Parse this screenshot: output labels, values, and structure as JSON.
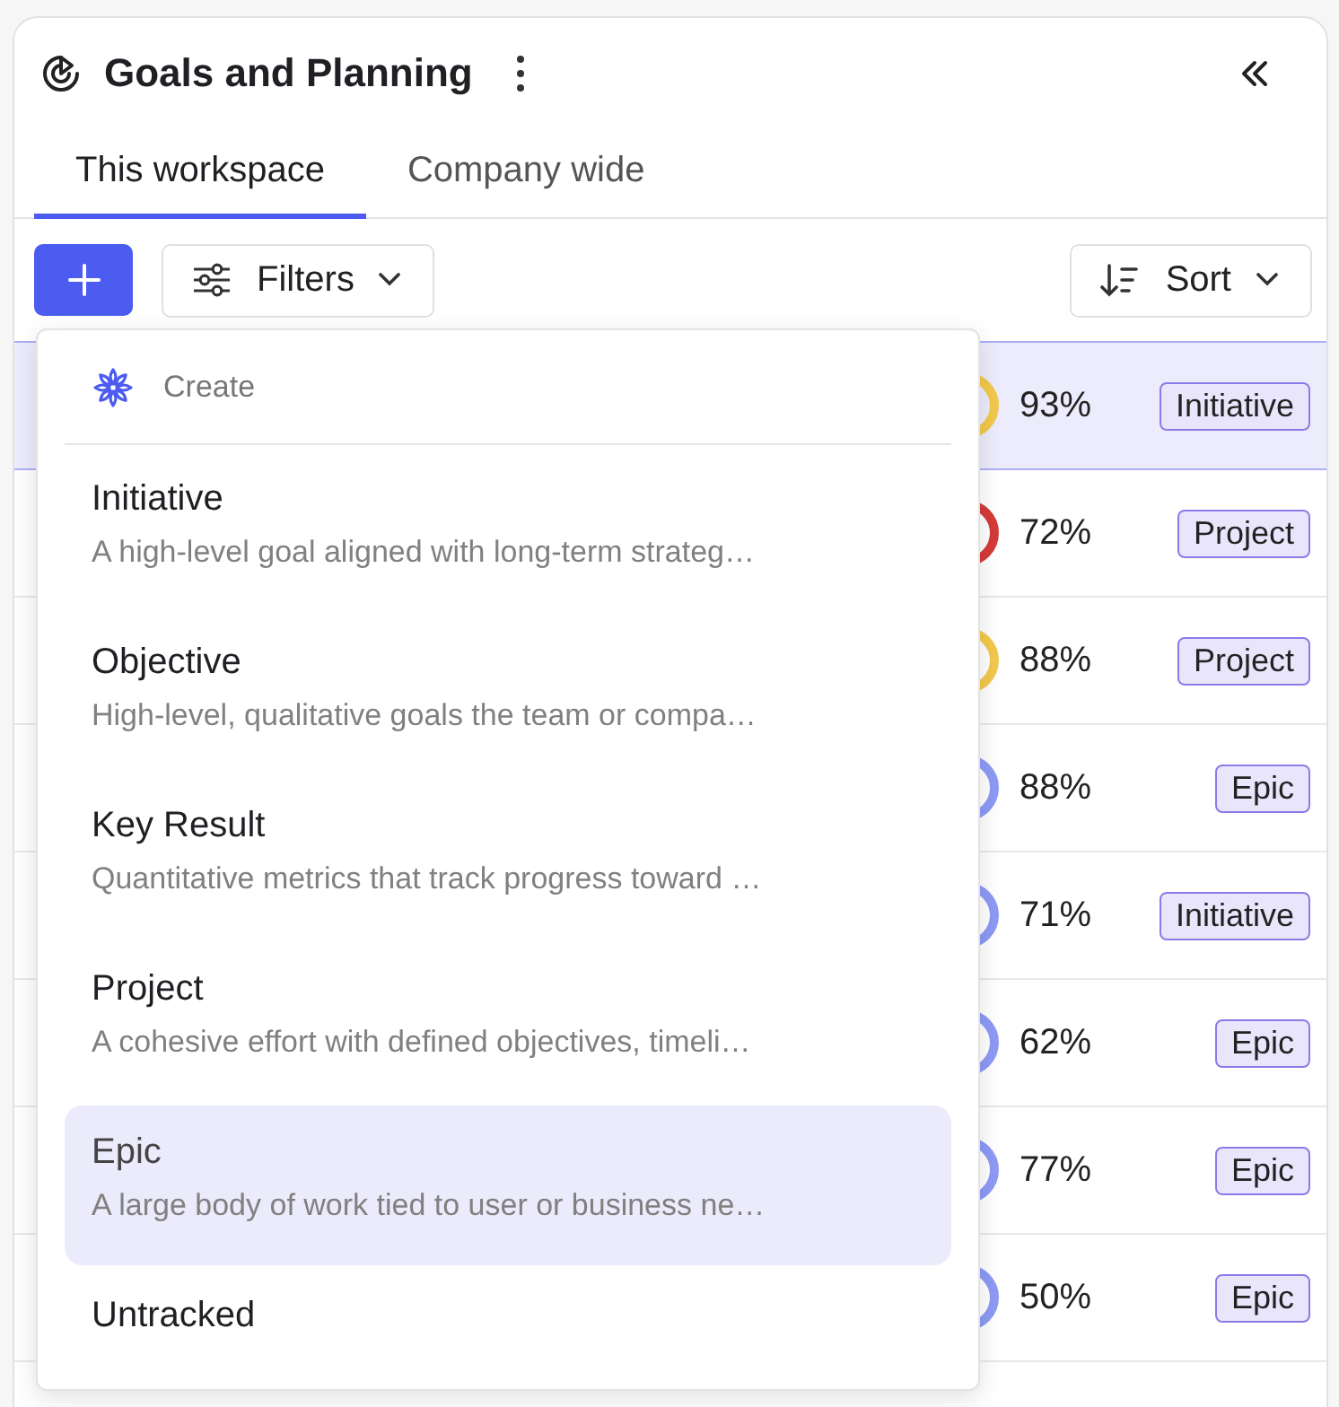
{
  "header": {
    "title": "Goals and Planning"
  },
  "tabs": [
    {
      "label": "This workspace",
      "selected": true
    },
    {
      "label": "Company wide",
      "selected": false
    }
  ],
  "toolbar": {
    "filters_label": "Filters",
    "sort_label": "Sort"
  },
  "rows": [
    {
      "progress": "93%",
      "tag": "Initiative",
      "color": "#f2c94c",
      "selected": true
    },
    {
      "progress": "72%",
      "tag": "Project",
      "color": "#d63a3a",
      "selected": false
    },
    {
      "progress": "88%",
      "tag": "Project",
      "color": "#f2c94c",
      "selected": false
    },
    {
      "progress": "88%",
      "tag": "Epic",
      "color": "#8e9af6",
      "selected": false
    },
    {
      "progress": "71%",
      "tag": "Initiative",
      "color": "#8e9af6",
      "selected": false
    },
    {
      "progress": "62%",
      "tag": "Epic",
      "color": "#8e9af6",
      "selected": false
    },
    {
      "progress": "77%",
      "tag": "Epic",
      "color": "#8e9af6",
      "selected": false
    },
    {
      "progress": "50%",
      "tag": "Epic",
      "color": "#8e9af6",
      "selected": false
    }
  ],
  "create_menu": {
    "heading": "Create",
    "items": [
      {
        "title": "Initiative",
        "description": "A high-level goal aligned with long-term strateg…",
        "selected": false
      },
      {
        "title": "Objective",
        "description": "High-level, qualitative goals the team or compa…",
        "selected": false
      },
      {
        "title": "Key Result",
        "description": "Quantitative metrics that track progress toward …",
        "selected": false
      },
      {
        "title": "Project",
        "description": "A cohesive effort with defined objectives, timeli…",
        "selected": false
      },
      {
        "title": "Epic",
        "description": "A large body of work tied to user or business ne…",
        "selected": true
      },
      {
        "title": "Untracked",
        "selected": false
      }
    ]
  }
}
